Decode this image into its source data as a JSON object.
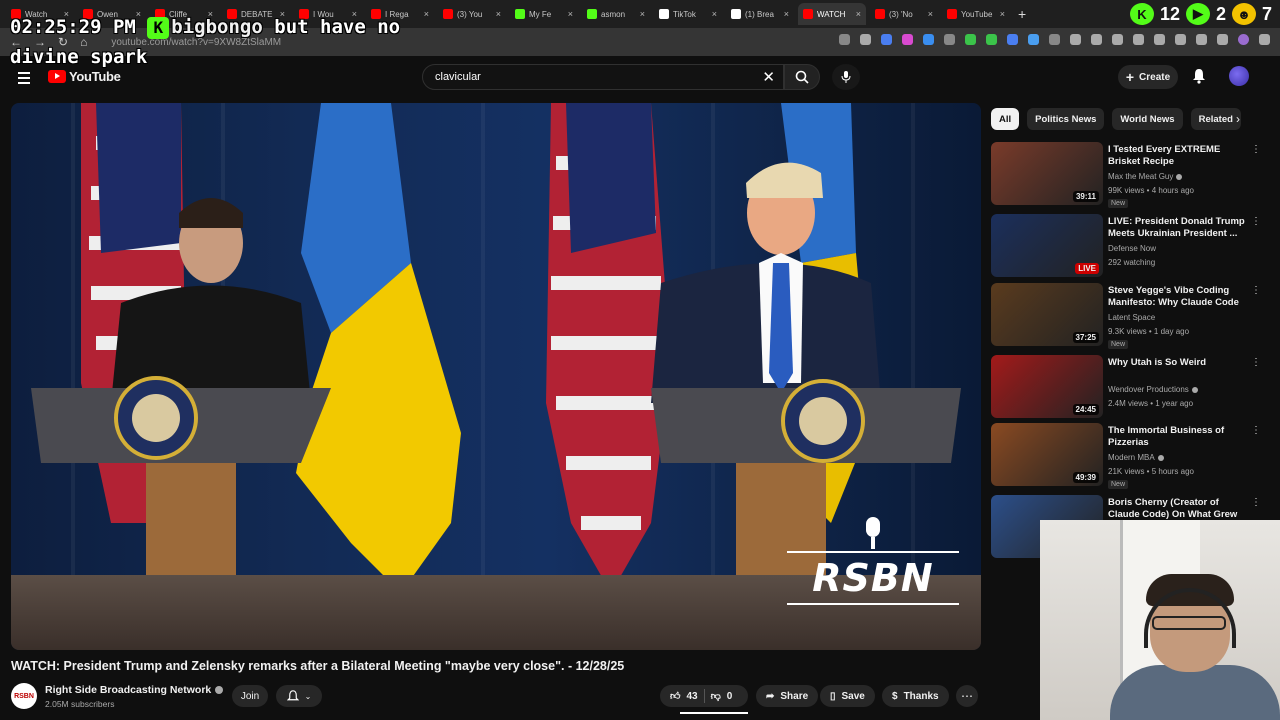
{
  "browser": {
    "tabs": [
      {
        "label": "Watch",
        "color": "#ff0000"
      },
      {
        "label": "Owen",
        "color": "#ff0000"
      },
      {
        "label": "Cliffe",
        "color": "#ff0000"
      },
      {
        "label": "DEBATE",
        "color": "#ff0000"
      },
      {
        "label": "I Wou",
        "color": "#ff0000"
      },
      {
        "label": "I Rega",
        "color": "#ff0000"
      },
      {
        "label": "(3) You",
        "color": "#ff0000"
      },
      {
        "label": "My Fe",
        "color": "#53fc18"
      },
      {
        "label": "asmon",
        "color": "#53fc18"
      },
      {
        "label": "TikTok",
        "color": "#ffffff"
      },
      {
        "label": "(1) Brea",
        "color": "#ffffff"
      },
      {
        "label": "WATCH",
        "color": "#ff0000",
        "active": true
      },
      {
        "label": "(3) 'No",
        "color": "#ff0000"
      },
      {
        "label": "YouTube",
        "color": "#ff0000"
      }
    ],
    "url": "youtube.com/watch?v=9XW8ZtSlaMM",
    "counters": {
      "a": "12",
      "b": "2",
      "c": "7"
    }
  },
  "overlay": {
    "clock": "02:25:29 PM",
    "chat_user": "bigbongo",
    "chat_message_1": "but have no",
    "chat_message_2": "divine spark"
  },
  "header": {
    "logo_text": "YouTube",
    "search_value": "clavicular",
    "search_placeholder": "Search",
    "create_label": "Create"
  },
  "video": {
    "title": "WATCH: President Trump and Zelensky remarks after a Bilateral Meeting \"maybe very close\". - 12/28/25",
    "watermark": "RSBN",
    "channel_avatar_text": "RSBN",
    "channel_name": "Right Side Broadcasting Network",
    "subscribers": "2.05M subscribers",
    "join_label": "Join",
    "likes": "43",
    "dislikes": "0",
    "share_label": "Share",
    "save_label": "Save",
    "thanks_label": "Thanks"
  },
  "chips": [
    "All",
    "Politics News",
    "World News",
    "Related"
  ],
  "recommendations": [
    {
      "title": "I Tested Every EXTREME Brisket Recipe",
      "channel": "Max the Meat Guy",
      "meta": "99K views • 4 hours ago",
      "duration": "39:11",
      "badge": "New",
      "verified": true,
      "thumb_color": "#7a3b2a"
    },
    {
      "title": "LIVE: President Donald Trump Meets Ukrainian President ...",
      "channel": "Defense Now",
      "meta": "292 watching",
      "duration": "LIVE",
      "badge": "",
      "verified": false,
      "thumb_color": "#1b2f5c"
    },
    {
      "title": "Steve Yegge's Vibe Coding Manifesto: Why Claude Code ...",
      "channel": "Latent Space",
      "meta": "9.3K views • 1 day ago",
      "duration": "37:25",
      "badge": "New",
      "verified": false,
      "thumb_color": "#5a3b1e"
    },
    {
      "title": "Why Utah is So Weird",
      "channel": "Wendover Productions",
      "meta": "2.4M views • 1 year ago",
      "duration": "24:45",
      "badge": "",
      "verified": true,
      "thumb_color": "#a31a1a"
    },
    {
      "title": "The Immortal Business of Pizzerias",
      "channel": "Modern MBA",
      "meta": "21K views • 5 hours ago",
      "duration": "49:39",
      "badge": "New",
      "verified": true,
      "thumb_color": "#8a4a22"
    },
    {
      "title": "Boris Cherny (Creator of Claude Code) On What Grew His Care...",
      "channel": "",
      "meta": "",
      "duration": "",
      "badge": "",
      "verified": false,
      "thumb_color": "#2c4f8a"
    }
  ]
}
